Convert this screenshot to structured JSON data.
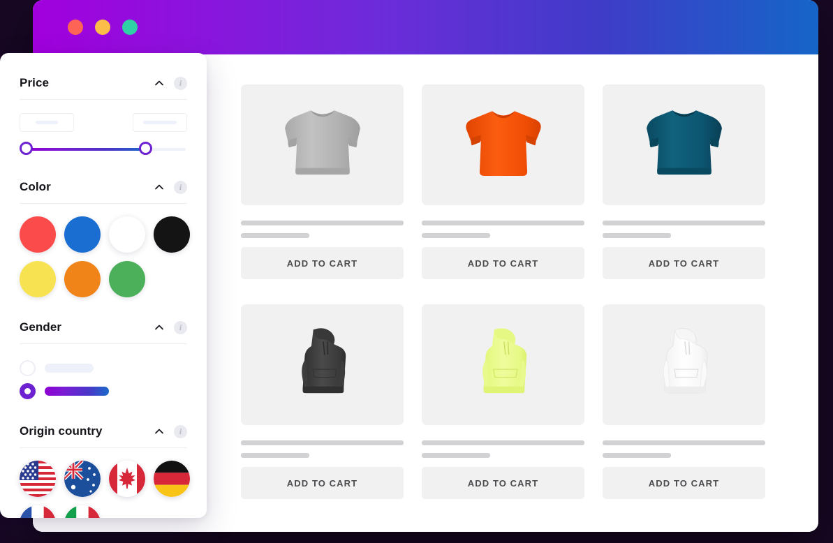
{
  "window": {
    "traffic_lights": [
      {
        "name": "close-button",
        "color": "#fd6455"
      },
      {
        "name": "minimize-button",
        "color": "#fcbe48"
      },
      {
        "name": "maximize-button",
        "color": "#2fd0a5"
      }
    ],
    "titlebar_gradient_from": "#a100dd",
    "titlebar_gradient_to": "#1565c8",
    "page_background": "#180824"
  },
  "sidebar": {
    "sections": [
      {
        "id": "price",
        "title": "Price",
        "collapse_icon": "chevron-up-icon",
        "info_icon": "info-icon",
        "min_input": {
          "value": "",
          "placeholder": ""
        },
        "max_input": {
          "value": "",
          "placeholder": ""
        },
        "slider": {
          "min_position_pct": 0,
          "max_position_pct": 74,
          "track_from": "#8f00d4",
          "track_to": "#1b69c9"
        }
      },
      {
        "id": "color",
        "title": "Color",
        "collapse_icon": "chevron-up-icon",
        "info_icon": "info-icon",
        "swatches": [
          {
            "name": "red",
            "hex": "#fc4b4b"
          },
          {
            "name": "blue",
            "hex": "#1a6ed1"
          },
          {
            "name": "white",
            "hex": "#ffffff"
          },
          {
            "name": "black",
            "hex": "#141414"
          },
          {
            "name": "yellow",
            "hex": "#f7e352"
          },
          {
            "name": "orange",
            "hex": "#f08418"
          },
          {
            "name": "green",
            "hex": "#4cb05b"
          }
        ]
      },
      {
        "id": "gender",
        "title": "Gender",
        "collapse_icon": "chevron-up-icon",
        "info_icon": "info-icon",
        "options": [
          {
            "name": "gender-option-1",
            "selected": false
          },
          {
            "name": "gender-option-2",
            "selected": true
          }
        ]
      },
      {
        "id": "origin-country",
        "title": "Origin country",
        "collapse_icon": "chevron-up-icon",
        "info_icon": "info-icon",
        "countries": [
          {
            "name": "united-states",
            "code": "US"
          },
          {
            "name": "australia",
            "code": "AU"
          },
          {
            "name": "canada",
            "code": "CA"
          },
          {
            "name": "germany",
            "code": "DE"
          },
          {
            "name": "france",
            "code": "FR"
          },
          {
            "name": "italy",
            "code": "IT"
          }
        ]
      }
    ]
  },
  "products": [
    {
      "id": "p1",
      "garment": "crewneck-sweatshirt",
      "color_name": "heather gray",
      "hex": "#b5b5b5",
      "add_to_cart_label": "ADD TO CART"
    },
    {
      "id": "p2",
      "garment": "t-shirt",
      "color_name": "orange",
      "hex": "#f2530d",
      "add_to_cart_label": "ADD TO CART"
    },
    {
      "id": "p3",
      "garment": "crewneck-sweatshirt",
      "color_name": "teal blue",
      "hex": "#0d5670",
      "add_to_cart_label": "ADD TO CART"
    },
    {
      "id": "p4",
      "garment": "hoodie",
      "color_name": "dark gray",
      "hex": "#3e3e3e",
      "add_to_cart_label": "ADD TO CART"
    },
    {
      "id": "p5",
      "garment": "hoodie",
      "color_name": "neon yellow",
      "hex": "#e9fa8a",
      "add_to_cart_label": "ADD TO CART"
    },
    {
      "id": "p6",
      "garment": "hoodie",
      "color_name": "white",
      "hex": "#fbfbfb",
      "add_to_cart_label": "ADD TO CART"
    }
  ]
}
